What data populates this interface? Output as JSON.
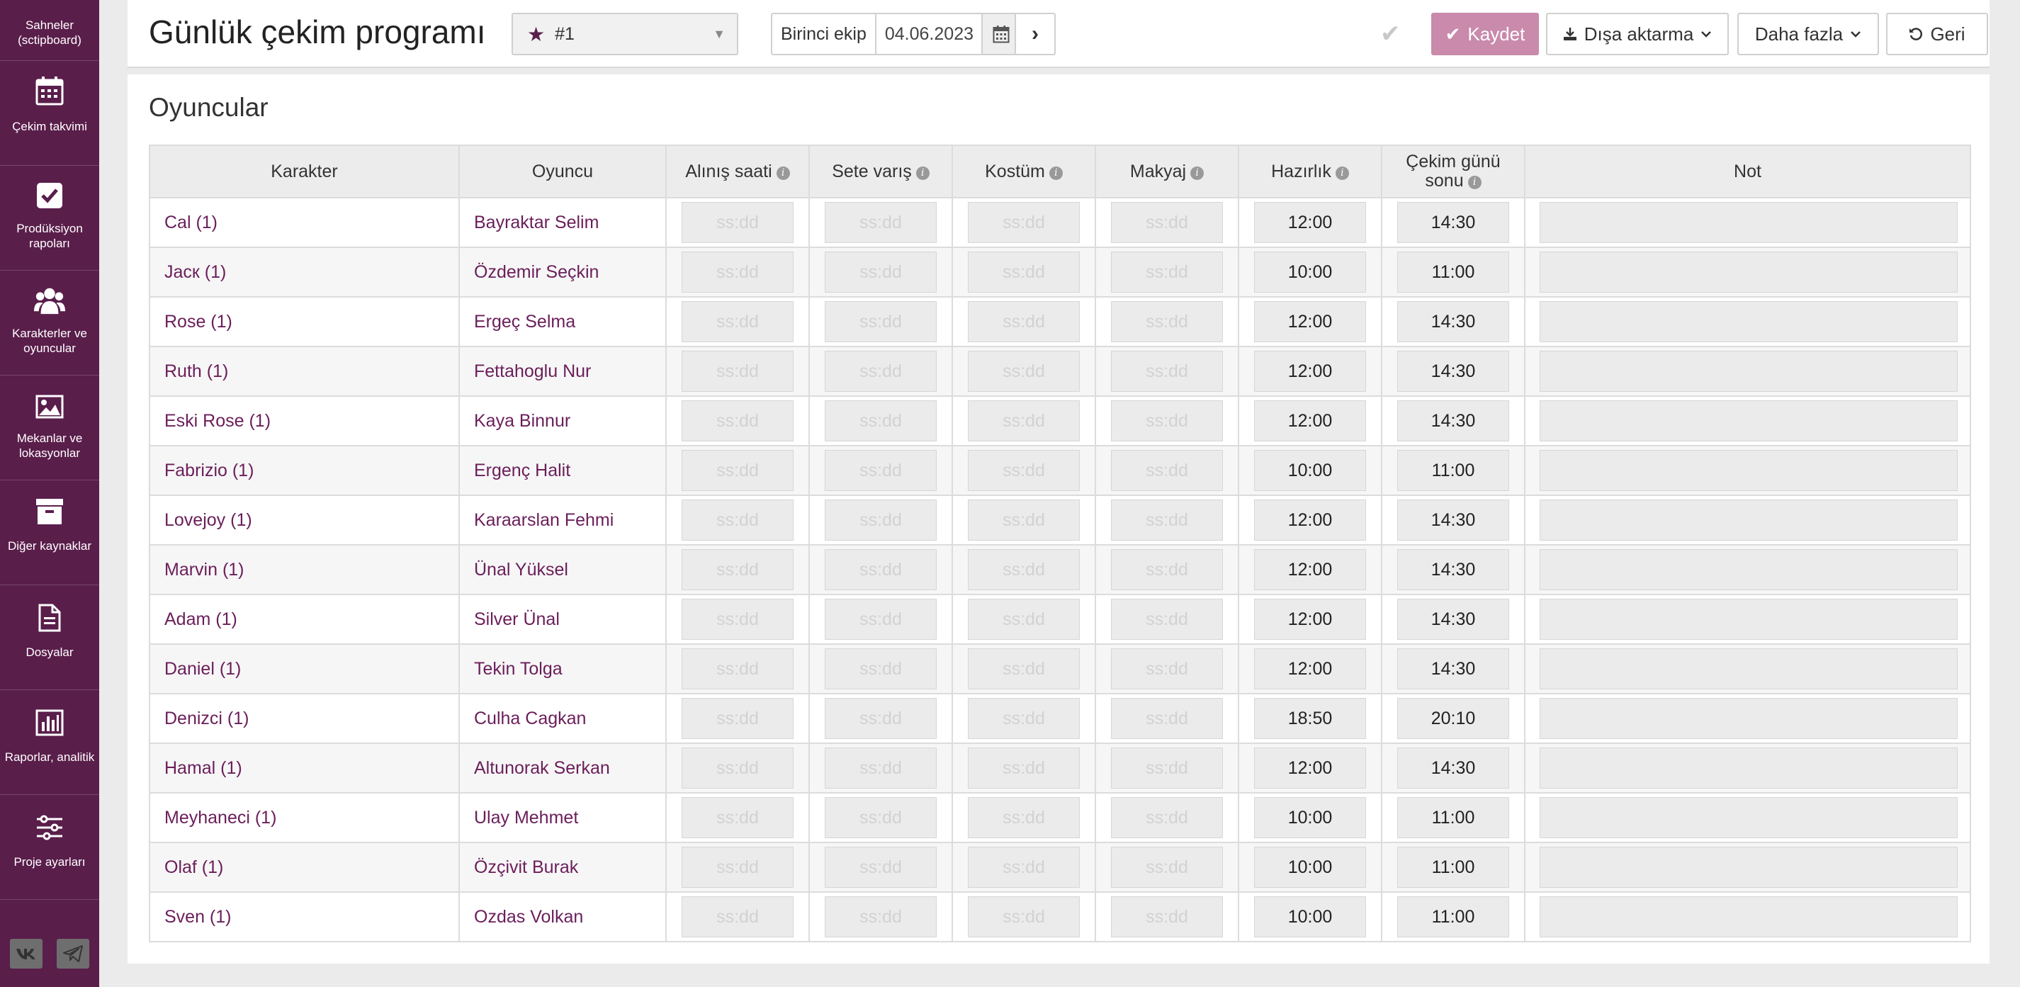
{
  "sidebar": {
    "items": [
      {
        "label": "Sahneler (sctipboard)",
        "icon": "scenes-icon"
      },
      {
        "label": "Çekim takvimi",
        "icon": "calendar-icon"
      },
      {
        "label": "Prodüksiyon rapoları",
        "icon": "checkbox-icon"
      },
      {
        "label": "Karakterler ve oyuncular",
        "icon": "users-icon"
      },
      {
        "label": "Mekanlar ve lokasyonlar",
        "icon": "image-icon"
      },
      {
        "label": "Diğer kaynaklar",
        "icon": "archive-icon"
      },
      {
        "label": "Dosyalar",
        "icon": "file-icon"
      },
      {
        "label": "Raporlar, analitik",
        "icon": "bar-chart-icon"
      },
      {
        "label": "Proje ayarları",
        "icon": "sliders-icon"
      }
    ]
  },
  "header": {
    "title": "Günlük çekim programı",
    "schedule_select": "#1",
    "team_label": "Birinci ekip",
    "date": "04.06.2023",
    "next": "›",
    "save": "Kaydet",
    "export": "Dışa aktarma",
    "more": "Daha fazla",
    "back": "Geri"
  },
  "section": {
    "title": "Oyuncular"
  },
  "table": {
    "headers": {
      "character": "Karakter",
      "actor": "Oyuncu",
      "pickup": "Alınış saati",
      "on_set": "Sete varış",
      "costume": "Kostüm",
      "makeup": "Makyaj",
      "ready": "Hazırlık",
      "wrap_line1": "Çekim günü",
      "wrap_line2": "sonu",
      "note": "Not"
    },
    "placeholder": "ss:dd",
    "rows": [
      {
        "character": "Cal (1)",
        "actor": "Bayraktar Selim",
        "ready": "12:00",
        "wrap": "14:30"
      },
      {
        "character": "Jacк (1)",
        "actor": "Özdemir Seçkin",
        "ready": "10:00",
        "wrap": "11:00"
      },
      {
        "character": "Rose (1)",
        "actor": "Ergeç Selma",
        "ready": "12:00",
        "wrap": "14:30"
      },
      {
        "character": "Ruth (1)",
        "actor": "Fettahoglu Nur",
        "ready": "12:00",
        "wrap": "14:30"
      },
      {
        "character": "Eski Rose (1)",
        "actor": "Kaya Binnur",
        "ready": "12:00",
        "wrap": "14:30"
      },
      {
        "character": "Fabrizio (1)",
        "actor": "Ergenç Halit",
        "ready": "10:00",
        "wrap": "11:00"
      },
      {
        "character": "Lovejoy (1)",
        "actor": "Karaarslan Fehmi",
        "ready": "12:00",
        "wrap": "14:30"
      },
      {
        "character": "Marvin (1)",
        "actor": "Ünal Yüksel",
        "ready": "12:00",
        "wrap": "14:30"
      },
      {
        "character": "Adam (1)",
        "actor": "Silver Ünal",
        "ready": "12:00",
        "wrap": "14:30"
      },
      {
        "character": "Daniel (1)",
        "actor": "Tekin Tolga",
        "ready": "12:00",
        "wrap": "14:30"
      },
      {
        "character": "Denizci (1)",
        "actor": "Culha Cagkan",
        "ready": "18:50",
        "wrap": "20:10"
      },
      {
        "character": "Hamal (1)",
        "actor": "Altunorak Serkan",
        "ready": "12:00",
        "wrap": "14:30"
      },
      {
        "character": "Meyhaneci (1)",
        "actor": "Ulay Mehmet",
        "ready": "10:00",
        "wrap": "11:00"
      },
      {
        "character": "Olaf (1)",
        "actor": "Özçivit Burak",
        "ready": "10:00",
        "wrap": "11:00"
      },
      {
        "character": "Sven (1)",
        "actor": "Ozdas Volkan",
        "ready": "10:00",
        "wrap": "11:00"
      }
    ]
  },
  "colors": {
    "sidebar": "#5a1e4b",
    "accent": "#6b1e5a",
    "save_button": "#c98aac"
  }
}
